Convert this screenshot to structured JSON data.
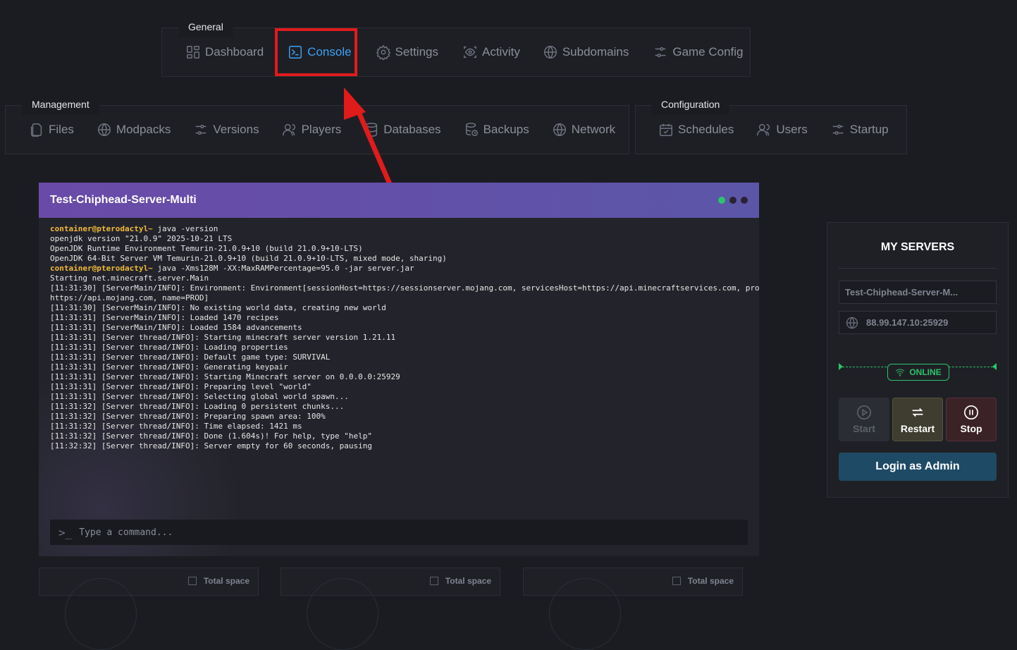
{
  "nav": {
    "general": {
      "title": "General",
      "items": [
        {
          "label": "Dashboard",
          "icon": "dashboard-icon"
        },
        {
          "label": "Console",
          "icon": "terminal-icon",
          "active": true
        },
        {
          "label": "Settings",
          "icon": "gear-icon"
        },
        {
          "label": "Activity",
          "icon": "eye-scan-icon"
        },
        {
          "label": "Subdomains",
          "icon": "globe-icon"
        },
        {
          "label": "Game Config",
          "icon": "sliders-icon"
        }
      ]
    },
    "management": {
      "title": "Management",
      "items": [
        {
          "label": "Files",
          "icon": "files-icon"
        },
        {
          "label": "Modpacks",
          "icon": "globe-icon"
        },
        {
          "label": "Versions",
          "icon": "sliders-icon"
        },
        {
          "label": "Players",
          "icon": "users-icon"
        },
        {
          "label": "Databases",
          "icon": "database-icon"
        },
        {
          "label": "Backups",
          "icon": "backup-icon"
        },
        {
          "label": "Network",
          "icon": "globe-icon"
        }
      ]
    },
    "configuration": {
      "title": "Configuration",
      "items": [
        {
          "label": "Schedules",
          "icon": "calendar-icon"
        },
        {
          "label": "Users",
          "icon": "users-icon"
        },
        {
          "label": "Startup",
          "icon": "sliders-icon"
        }
      ]
    }
  },
  "console": {
    "title": "Test-Chiphead-Server-Multi",
    "lines": [
      {
        "prompt": "container@pterodactyl~",
        "text": " java -version"
      },
      {
        "text": "openjdk version \"21.0.9\" 2025-10-21 LTS"
      },
      {
        "text": "OpenJDK Runtime Environment Temurin-21.0.9+10 (build 21.0.9+10-LTS)"
      },
      {
        "text": "OpenJDK 64-Bit Server VM Temurin-21.0.9+10 (build 21.0.9+10-LTS, mixed mode, sharing)"
      },
      {
        "prompt": "container@pterodactyl~",
        "text": " java -Xms128M -XX:MaxRAMPercentage=95.0 -jar server.jar"
      },
      {
        "text": "Starting net.minecraft.server.Main"
      },
      {
        "text": "[11:31:30] [ServerMain/INFO]: Environment: Environment[sessionHost=https://sessionserver.mojang.com, servicesHost=https://api.minecraftservices.com, profilesHost="
      },
      {
        "text": "https://api.mojang.com, name=PROD]"
      },
      {
        "text": "[11:31:30] [ServerMain/INFO]: No existing world data, creating new world"
      },
      {
        "text": "[11:31:31] [ServerMain/INFO]: Loaded 1470 recipes"
      },
      {
        "text": "[11:31:31] [ServerMain/INFO]: Loaded 1584 advancements"
      },
      {
        "text": "[11:31:31] [Server thread/INFO]: Starting minecraft server version 1.21.11"
      },
      {
        "text": "[11:31:31] [Server thread/INFO]: Loading properties"
      },
      {
        "text": "[11:31:31] [Server thread/INFO]: Default game type: SURVIVAL"
      },
      {
        "text": "[11:31:31] [Server thread/INFO]: Generating keypair"
      },
      {
        "text": "[11:31:31] [Server thread/INFO]: Starting Minecraft server on 0.0.0.0:25929"
      },
      {
        "text": "[11:31:31] [Server thread/INFO]: Preparing level \"world\""
      },
      {
        "text": "[11:31:31] [Server thread/INFO]: Selecting global world spawn..."
      },
      {
        "text": "[11:31:32] [Server thread/INFO]: Loading 0 persistent chunks..."
      },
      {
        "text": "[11:31:32] [Server thread/INFO]: Preparing spawn area: 100%"
      },
      {
        "text": "[11:31:32] [Server thread/INFO]: Time elapsed: 1421 ms"
      },
      {
        "text": "[11:31:32] [Server thread/INFO]: Done (1.604s)! For help, type \"help\""
      },
      {
        "text": "[11:32:32] [Server thread/INFO]: Server empty for 60 seconds, pausing"
      }
    ],
    "input_placeholder": "Type a command..."
  },
  "servers": {
    "heading": "MY SERVERS",
    "server_name": "Test-Chiphead-Server-M...",
    "address": "88.99.147.10:25929",
    "status": "ONLINE",
    "start_label": "Start",
    "restart_label": "Restart",
    "stop_label": "Stop",
    "admin_label": "Login as Admin"
  },
  "storage_cards": [
    {
      "label": "Total space"
    },
    {
      "label": "Total space"
    },
    {
      "label": "Total space"
    }
  ],
  "colors": {
    "accent": "#3aa3f5",
    "online": "#2bc46a",
    "highlight": "#e01b1b",
    "prompt": "#f0b93a"
  }
}
